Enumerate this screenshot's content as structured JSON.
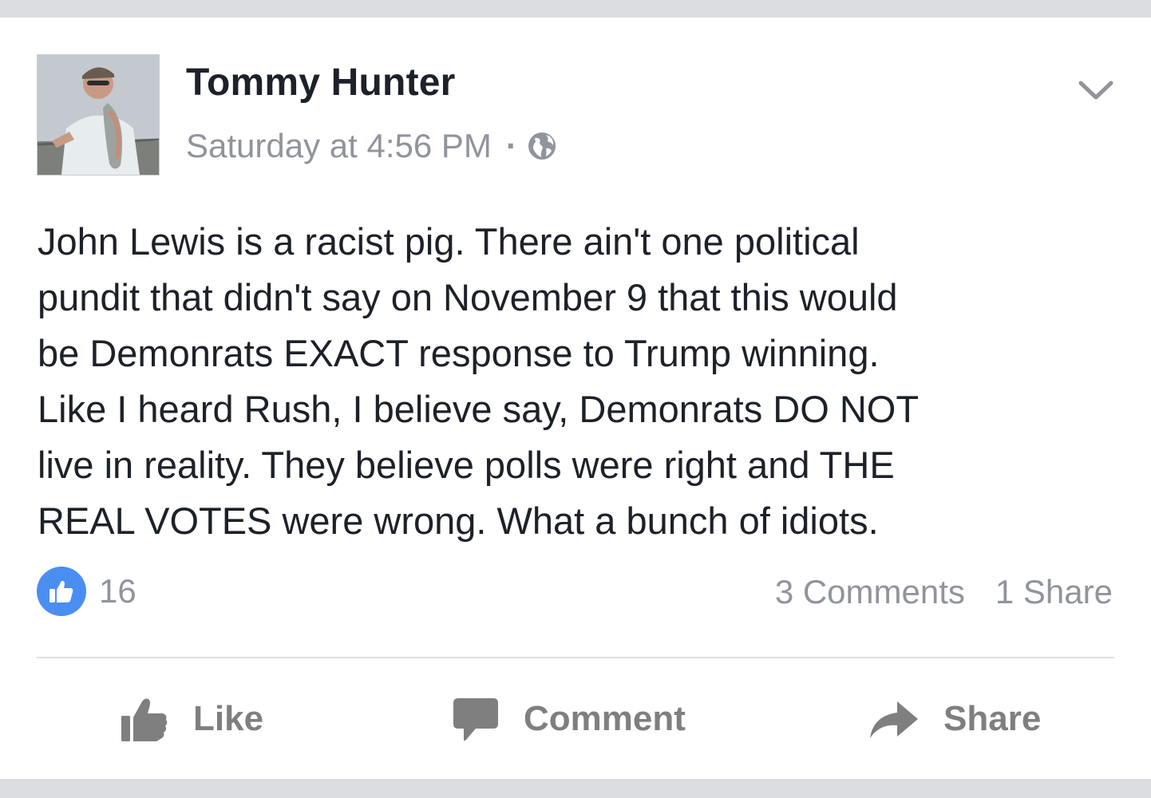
{
  "post": {
    "author": "Tommy Hunter",
    "timestamp": "Saturday at 4:56 PM",
    "separator": "·",
    "privacy_icon": "globe-icon",
    "menu_icon": "chevron-down-icon",
    "text_lines": [
      "John Lewis is a racist pig.  There ain't one political",
      "pundit that didn't say on November 9 that this would",
      "be Demonrats EXACT response to Trump winning.",
      "Like I heard Rush, I believe say, Demonrats DO NOT",
      "live in reality. They believe polls were right and THE",
      "REAL VOTES were wrong. What a bunch of idiots."
    ]
  },
  "stats": {
    "like_icon": "thumbs-up-icon",
    "like_count": "16",
    "comments": "3 Comments",
    "shares": "1 Share"
  },
  "actions": {
    "like_label": "Like",
    "comment_label": "Comment",
    "share_label": "Share"
  },
  "colors": {
    "page_background": "#dcdde1",
    "card_background": "#ffffff",
    "primary_text": "#1d2129",
    "secondary_text": "#90949c",
    "action_gray": "#7f7f7f",
    "like_blue": "#4b8ef2",
    "divider": "#dddfe2"
  }
}
